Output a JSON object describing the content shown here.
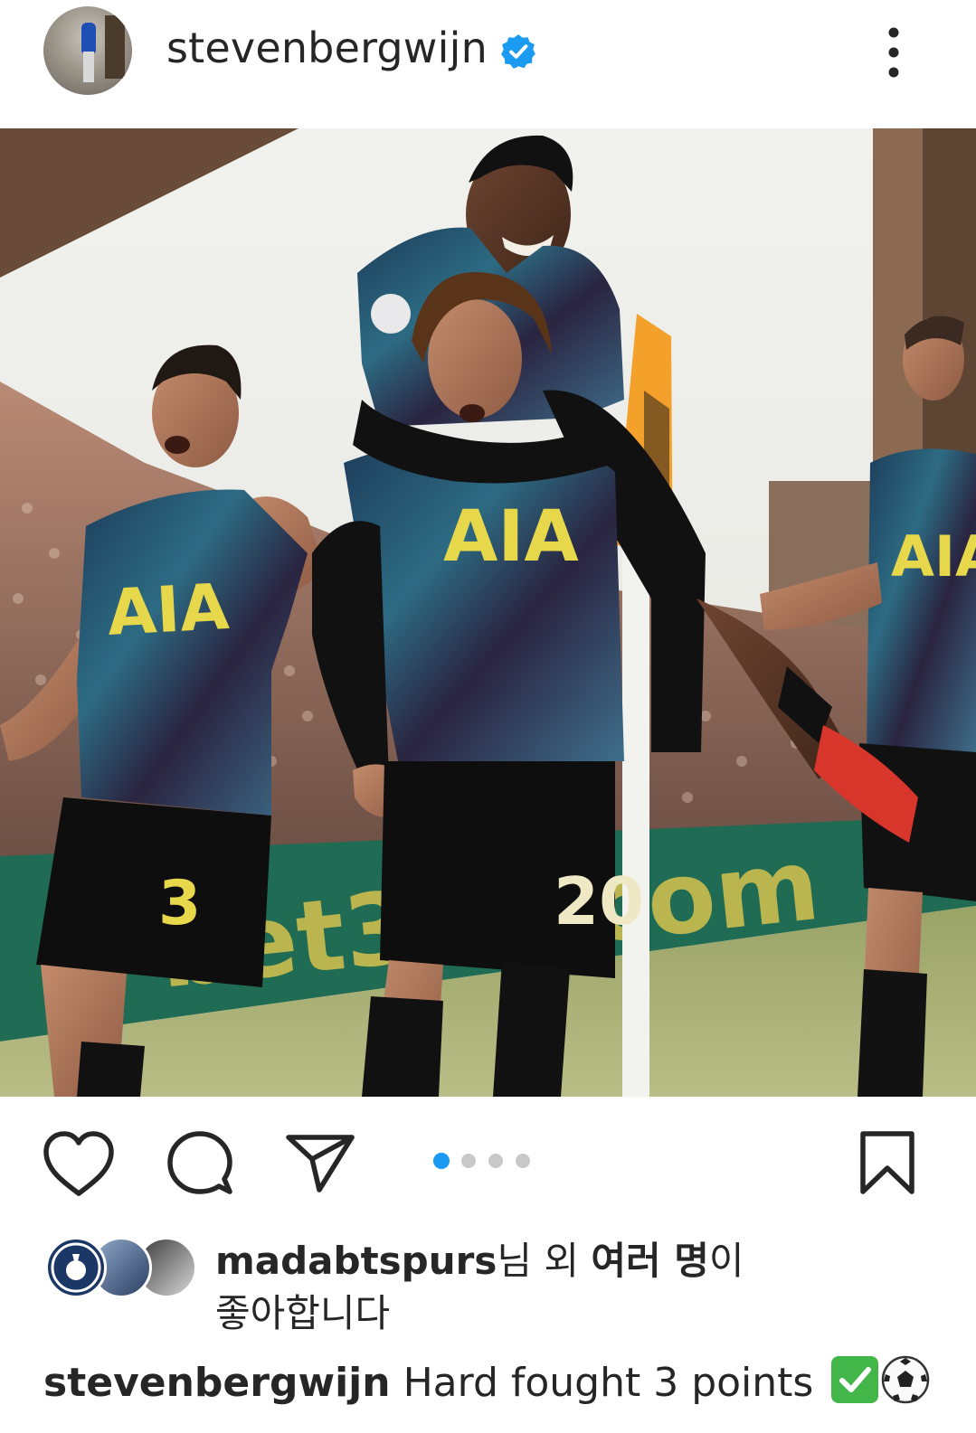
{
  "post": {
    "author": "stevenbergwijn",
    "verified": true,
    "media_count": 4,
    "media_index": 1
  },
  "likes": {
    "user": "madabtspurs",
    "suffix1": "님 외 ",
    "bold": "여러 명",
    "suffix2": "이",
    "line2": "좋아합니다"
  },
  "caption": {
    "user": "stevenbergwijn",
    "text": "Hard fought 3 points"
  },
  "photo": {
    "jersey_sponsor": "AIA",
    "number_left": "3",
    "number_center": "20"
  },
  "icons": {
    "like": "heart-icon",
    "comment": "comment-bubble-icon",
    "share": "paper-plane-icon",
    "save": "bookmark-icon",
    "more": "more-vertical-icon",
    "verified": "verified-badge-icon"
  },
  "colors": {
    "text": "#262626",
    "verified_blue": "#1a9af0",
    "active_dot": "#1a9af0",
    "inactive_dot": "#c9c9c9"
  }
}
